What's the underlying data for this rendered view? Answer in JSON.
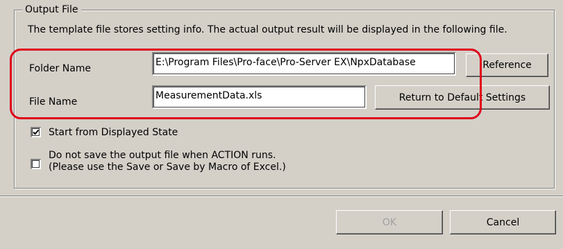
{
  "group": {
    "title": "Output File",
    "description": "The template file stores setting info. The actual output result will be displayed in the following file."
  },
  "folder": {
    "label": "Folder Name",
    "value": "E:\\Program Files\\Pro-face\\Pro-Server EX\\NpxDatabase",
    "button": "Reference"
  },
  "file": {
    "label": "File Name",
    "value": "MeasurementData.xls",
    "button": "Return to Default Settings"
  },
  "options": {
    "start_displayed": {
      "label": "Start from Displayed State",
      "checked": true
    },
    "no_save": {
      "line1": "Do not save the output file when ACTION runs.",
      "line2": "(Please use the Save or Save by Macro of Excel.)",
      "checked": false
    }
  },
  "buttons": {
    "ok": "OK",
    "cancel": "Cancel"
  },
  "colors": {
    "highlight": "#e0001a",
    "dialog": "#d4d0c8"
  }
}
